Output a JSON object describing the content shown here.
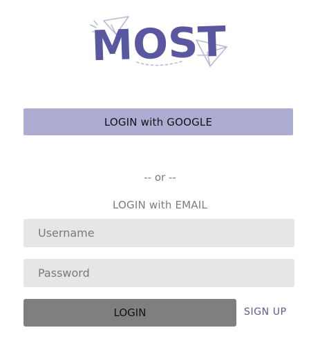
{
  "brand": {
    "logo_text": "MOST",
    "logo_color": "#5a57a1",
    "logo_decoration_color": "#b8b8d8"
  },
  "google_login": {
    "label": "LOGIN with GOOGLE",
    "color": "#adadd3"
  },
  "divider": {
    "text": "-- or --"
  },
  "email_login": {
    "heading": "LOGIN with EMAIL",
    "username": {
      "value": "",
      "placeholder": "Username"
    },
    "password": {
      "value": "",
      "placeholder": "Password"
    },
    "login_label": "LOGIN",
    "login_color": "#7f7f7f",
    "signup_label": "SIGN UP",
    "signup_color": "#5a5a9a"
  }
}
